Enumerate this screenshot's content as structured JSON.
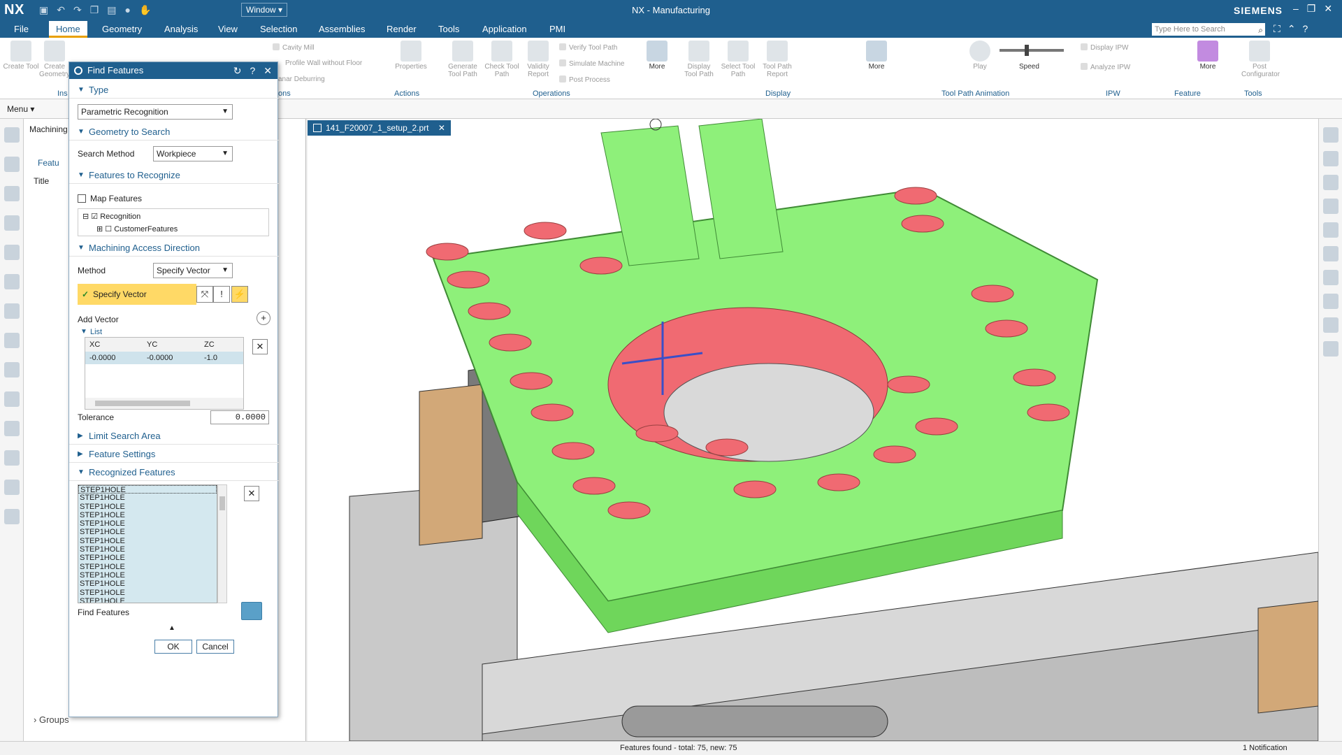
{
  "titlebar": {
    "logo": "NX",
    "window_menu": "Window ▾",
    "title": "NX - Manufacturing",
    "brand": "SIEMENS"
  },
  "ribbon_tabs": [
    {
      "label": "File"
    },
    {
      "label": "Home"
    },
    {
      "label": "Geometry"
    },
    {
      "label": "Analysis"
    },
    {
      "label": "View"
    },
    {
      "label": "Selection"
    },
    {
      "label": "Assemblies"
    },
    {
      "label": "Render"
    },
    {
      "label": "Tools"
    },
    {
      "label": "Application"
    },
    {
      "label": "PMI"
    }
  ],
  "search": {
    "placeholder": "Type Here to Search"
  },
  "ribbon": {
    "create_tool": "Create Tool",
    "create_geometry": "Create Geometry",
    "cavity_mill": "Cavity Mill",
    "profile_wall": "Profile Wall without Floor",
    "planar_deburring": "anar Deburring",
    "properties": "Properties",
    "generate_tool_path": "Generate Tool Path",
    "check_tool_path": "Check Tool Path",
    "validity_report": "Validity Report",
    "verify_tool_path": "Verify Tool Path",
    "simulate_machine": "Simulate Machine",
    "post_process": "Post Process",
    "more1": "More",
    "display_tool_path": "Display Tool Path",
    "select_tool_path": "Select Tool Path",
    "tool_path_report": "Tool Path Report",
    "more2": "More",
    "play": "Play",
    "speed": "Speed",
    "display_ipw": "Display IPW",
    "analyze_ipw": "Analyze IPW",
    "more3": "More",
    "post_configurator": "Post Configurator",
    "groups": {
      "actions": "Actions",
      "operations": "Operations",
      "display": "Display",
      "animation": "Tool Path Animation",
      "ipw": "IPW",
      "feature": "Feature",
      "tools": "Tools",
      "ins": "Ins",
      "ons": "ons"
    }
  },
  "cmdbar": {
    "menu": "Menu ▾"
  },
  "navigator": {
    "header": "Machining",
    "features_label": "Featu",
    "title_col": "Title",
    "groups": "Groups"
  },
  "document_tab": {
    "name": "141_F20007_1_setup_2.prt"
  },
  "dialog": {
    "title": "Find Features",
    "sections": {
      "type": "Type",
      "geometry": "Geometry to Search",
      "recognize": "Features to Recognize",
      "access": "Machining Access Direction",
      "limit": "Limit Search Area",
      "settings": "Feature Settings",
      "recognized": "Recognized Features",
      "list": "List"
    },
    "type_value": "Parametric Recognition",
    "search_method_label": "Search Method",
    "search_method_value": "Workpiece",
    "map_features": "Map Features",
    "tree": {
      "recognition": "Recognition",
      "customer": "CustomerFeatures"
    },
    "method_label": "Method",
    "method_value": "Specify Vector",
    "specify_vector": "Specify Vector",
    "add_vector": "Add Vector",
    "grid": {
      "headers": [
        "XC",
        "YC",
        "ZC"
      ],
      "row": [
        "-0.0000",
        "-0.0000",
        "-1.0"
      ]
    },
    "tolerance_label": "Tolerance",
    "tolerance_value": "0.0000",
    "recognized_items": [
      "STEP1HOLE",
      "STEP1HOLE",
      "STEP1HOLE",
      "STEP1HOLE",
      "STEP1HOLE",
      "STEP1HOLE",
      "STEP1HOLE",
      "STEP1HOLE",
      "STEP1HOLE",
      "STEP1HOLE",
      "STEP1HOLE",
      "STEP1HOLE",
      "STEP1HOLE",
      "STEP1HOLE"
    ],
    "find_features_label": "Find Features",
    "ok": "OK",
    "cancel": "Cancel"
  },
  "status": {
    "message": "Features found - total: 75, new: 75",
    "notification": "1 Notification"
  },
  "colors": {
    "brand_blue": "#1f5f8e",
    "part_green": "#8ef07a",
    "hole_red": "#f06a72",
    "highlight_yellow": "#ffd966"
  }
}
